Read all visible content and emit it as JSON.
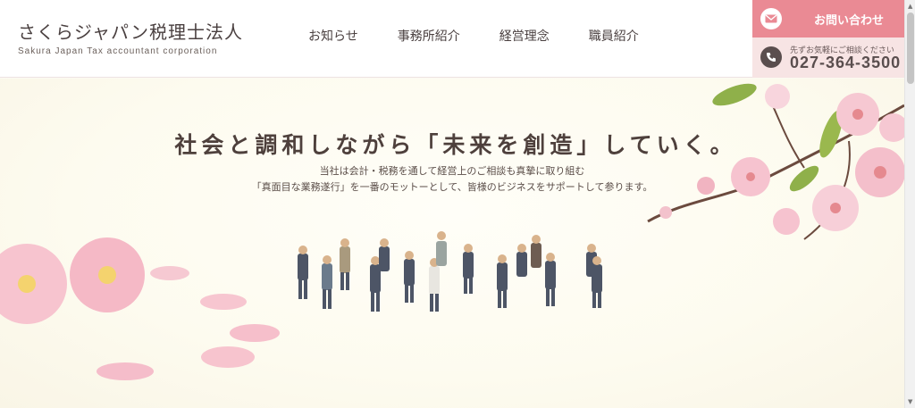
{
  "header": {
    "logo_main": "さくらジャパン税理士法人",
    "logo_sub": "Sakura Japan Tax accountant corporation",
    "nav": [
      "お知らせ",
      "事務所紹介",
      "経営理念",
      "職員紹介"
    ],
    "contact_label": "お問い合わせ",
    "phone_note": "先ずお気軽にご相談ください",
    "phone_number": "027-364-3500"
  },
  "hero": {
    "tagline": "社会と調和しながら「未来を創造」していく。",
    "desc_line1": "当社は会計・税務を通して経営上のご相談も真摯に取り組む",
    "desc_line2": "「真面目な業務遂行」を一番のモットーとして、皆様のビジネスをサポートして参ります。"
  },
  "colors": {
    "accent_pink": "#ea8a94",
    "phone_bg": "#f6e2e2",
    "hero_bg": "#fcfaf2",
    "text_dark": "#4a4040"
  },
  "icons": [
    "mail-icon",
    "phone-icon",
    "cherry-blossom-illustration",
    "miniature-business-people-illustration"
  ]
}
